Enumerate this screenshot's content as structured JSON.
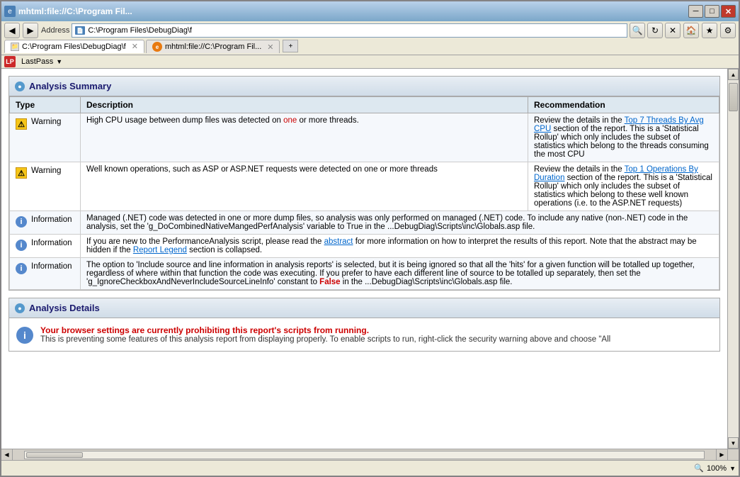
{
  "window": {
    "title": "mhtml:file://C:\\Program Fil...",
    "address_bar_1": "C:\\Program Files\\DebugDiag\\f",
    "address_bar_2": "mhtml:file://C:\\Program Fil...",
    "tab1_label": "C:\\Program Files\\DebugDiag\\f",
    "tab2_label": "mhtml:file://C:\\Program Fil...",
    "lastpass_label": "LastPass",
    "minimize_icon": "─",
    "restore_icon": "□",
    "close_icon": "✕"
  },
  "analysis_summary": {
    "title": "Analysis Summary",
    "columns": {
      "type": "Type",
      "description": "Description",
      "recommendation": "Recommendation"
    },
    "rows": [
      {
        "type": "Warning",
        "icon": "warning",
        "description": "High CPU usage between dump files was detected on one or more threads.",
        "recommendation_before": "Review the details in the ",
        "recommendation_link": "Top 7 Threads By Avg CPU",
        "recommendation_after": " section of the report. This is a 'Statistical Rollup' which only includes the subset of statistics which belong to the threads consuming the most CPU",
        "has_link": true
      },
      {
        "type": "Warning",
        "icon": "warning",
        "description": "Well known operations, such as ASP or ASP.NET requests were detected on one or more threads",
        "recommendation_before": "Review the details in the ",
        "recommendation_link": "Top 1 Operations By Duration",
        "recommendation_after": " section of the report. This is a 'Statistical Rollup' which only includes the subset of statistics which belong to these well known operations (i.e. to the ASP.NET requests)",
        "has_link": true
      },
      {
        "type": "Information",
        "icon": "info",
        "description": "Managed (.NET) code was detected in one or more dump files, so analysis was only performed on managed (.NET) code. To include any native (non-.NET) code in the analysis, set the 'g_DoCombinedNativeMangedPerfAnalysis' variable to True in the ...DebugDiag\\Scripts\\inc\\Globals.asp file.",
        "recommendation": "",
        "has_link": false
      },
      {
        "type": "Information",
        "icon": "info",
        "description_before": "If you are new to the PerformanceAnalysis script, please read the ",
        "description_link1": "abstract",
        "description_middle": " for more information on how to interpret the results of this report.   Note that the abstract may be hidden if the ",
        "description_link2": "Report Legend",
        "description_after": " section is collapsed.",
        "recommendation": "",
        "has_link": true,
        "special_links": true
      },
      {
        "type": "Information",
        "icon": "info",
        "description_before": "The option to 'Include source and line information in analysis reports' is selected, but it is being ignored so that all the 'hits' for a given function will be totalled up together, regardless of where within that function the code was executing. If you prefer to have each different line of source to be totalled up separately, then set the 'g_IgnoreCheckboxAndNeverIncludeSourceLineInfo' constant to ",
        "description_red": "False",
        "description_after": " in the ...DebugDiag\\Scripts\\inc\\Globals.asp file.",
        "recommendation": "",
        "has_link": false,
        "has_red": true
      }
    ]
  },
  "analysis_details": {
    "title": "Analysis Details",
    "browser_warning_bold": "Your browser settings are currently prohibiting this report's scripts from running.",
    "browser_warning_normal": "This is preventing some features of this analysis report from displaying properly. To enable scripts to run, right-click the security warning above and choose \"All"
  },
  "status_bar": {
    "zoom_label": "100%",
    "zoom_icon": "🔍"
  }
}
